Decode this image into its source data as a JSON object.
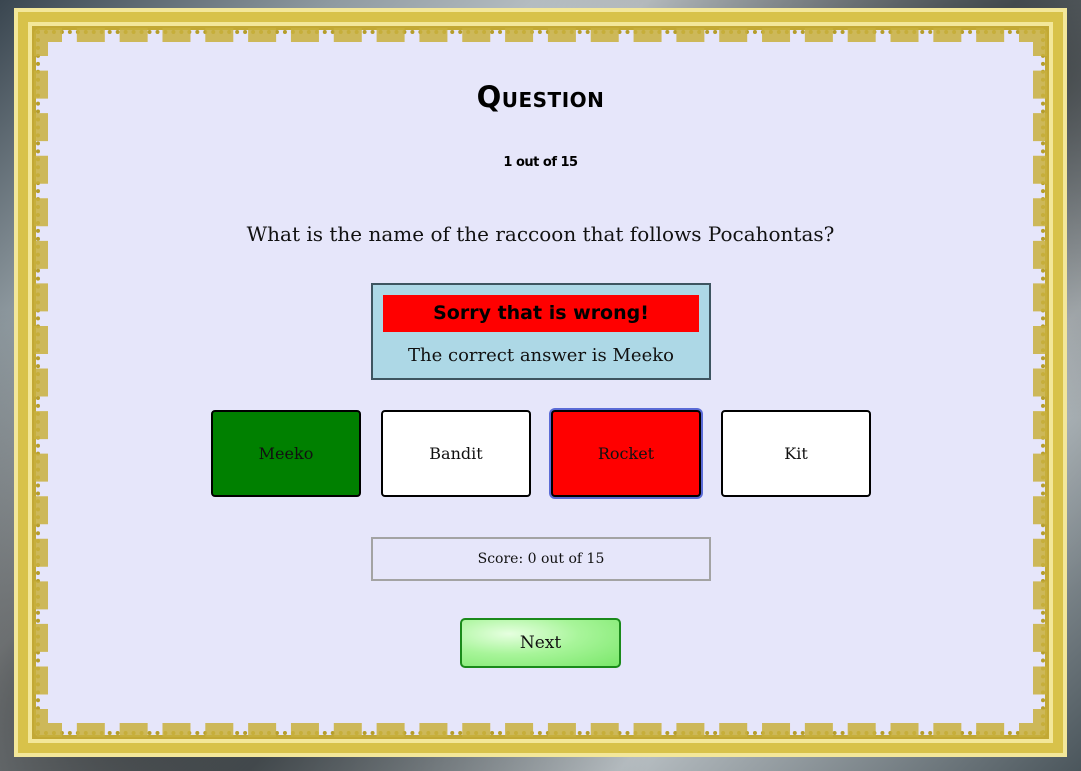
{
  "quiz": {
    "title": "Question",
    "counter": "1 out of 15",
    "question": "What is the name of the raccoon that follows Pocahontas?"
  },
  "feedback": {
    "banner": "Sorry that is wrong!",
    "message": "The correct answer is Meeko",
    "banner_color": "#ff0000",
    "panel_color": "#add8e6"
  },
  "answers": [
    {
      "label": "Meeko",
      "state": "correct"
    },
    {
      "label": "Bandit",
      "state": "neutral"
    },
    {
      "label": "Rocket",
      "state": "wrong-selected"
    },
    {
      "label": "Kit",
      "state": "neutral"
    }
  ],
  "score": {
    "text": "Score: 0 out of 15"
  },
  "controls": {
    "next_label": "Next"
  },
  "colors": {
    "correct": "#008000",
    "wrong": "#ff0000",
    "background": "#e6e6fa",
    "next_button": "#90ee90"
  }
}
